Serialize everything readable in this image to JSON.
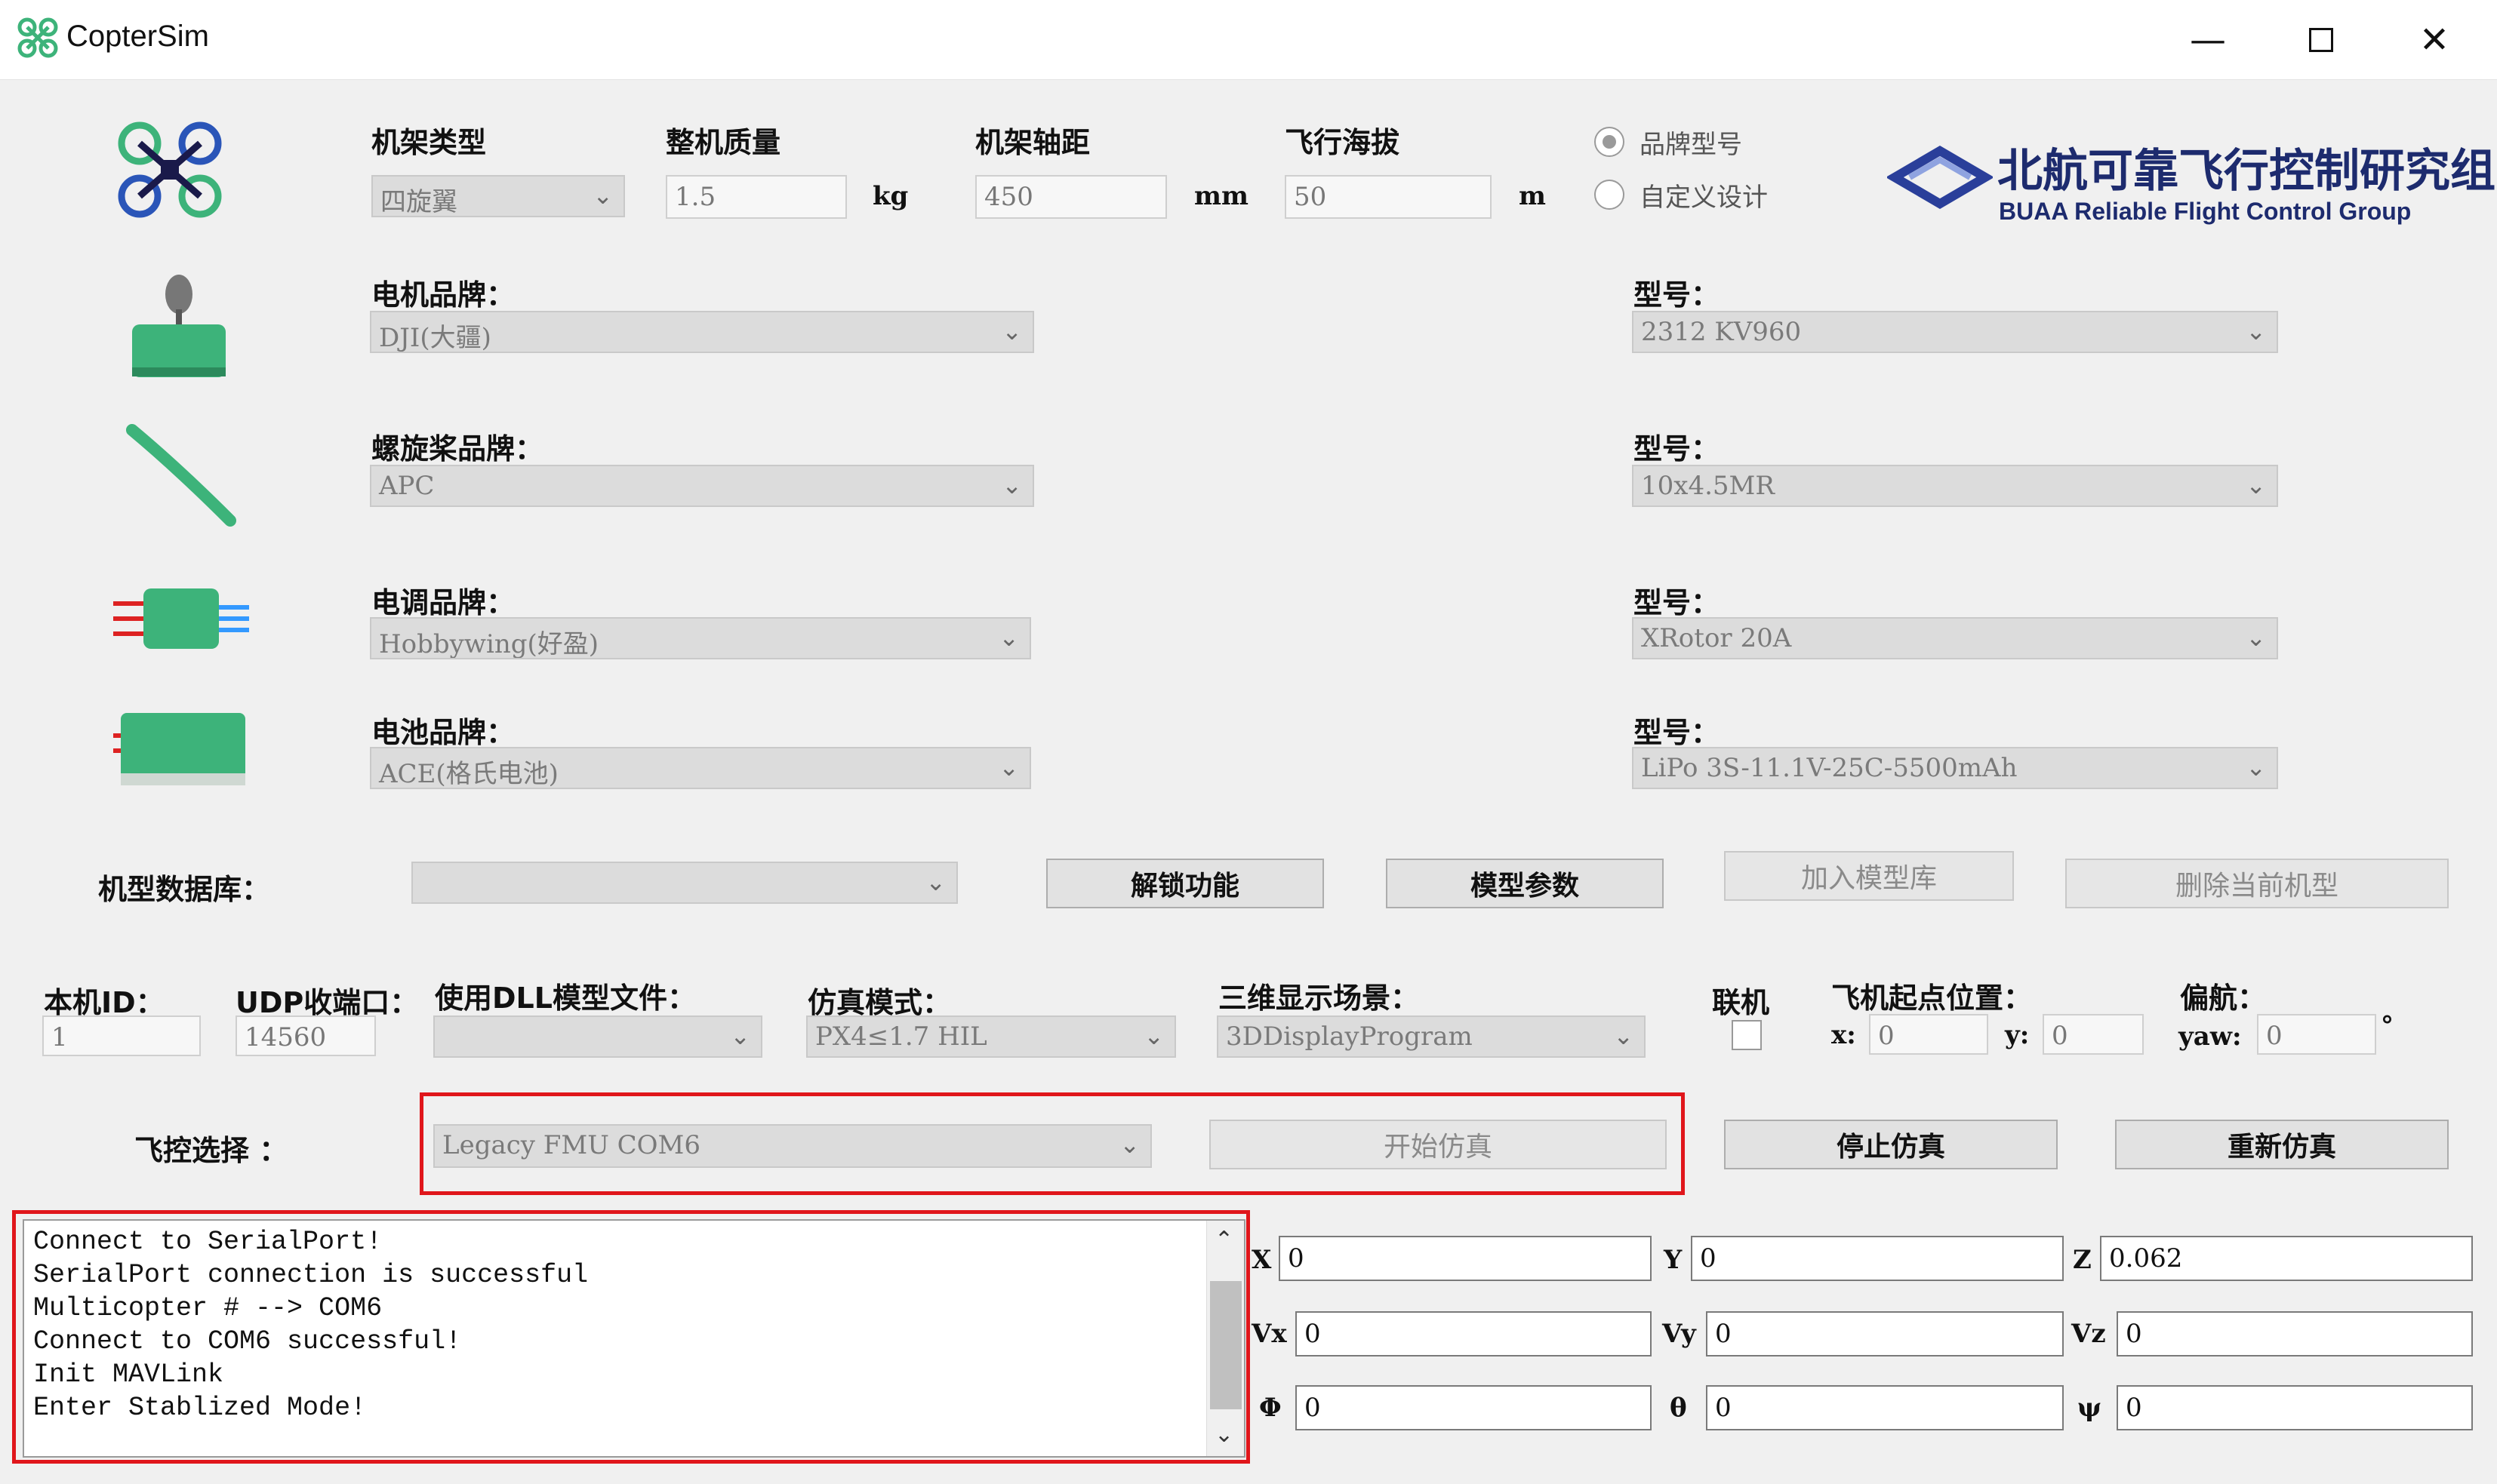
{
  "app": {
    "title": "CopterSim"
  },
  "colors": {
    "accent_red": "#e0161b",
    "logo_blue": "#2a3f9a",
    "motor_green": "#3db37a"
  },
  "frame": {
    "type_label": "机架类型",
    "type_value": "四旋翼",
    "mass_label": "整机质量",
    "mass_value": "1.5",
    "mass_unit": "kg",
    "wheelbase_label": "机架轴距",
    "wheelbase_value": "450",
    "wheelbase_unit": "mm",
    "altitude_label": "飞行海拔",
    "altitude_value": "50",
    "altitude_unit": "m"
  },
  "model_mode": {
    "option_brand": "品牌型号",
    "option_custom": "自定义设计",
    "selected": "品牌型号"
  },
  "logo": {
    "title_cn": "北航可靠飞行控制研究组",
    "title_en": "BUAA Reliable Flight Control Group"
  },
  "components": [
    {
      "icon": "motor-icon",
      "brand_label": "电机品牌：",
      "brand_value": "DJI(大疆)",
      "model_label": "型号：",
      "model_value": "2312 KV960"
    },
    {
      "icon": "propeller-icon",
      "brand_label": "螺旋桨品牌：",
      "brand_value": "APC",
      "model_label": "型号：",
      "model_value": "10x4.5MR"
    },
    {
      "icon": "esc-icon",
      "brand_label": "电调品牌：",
      "brand_value": "Hobbywing(好盈)",
      "model_label": "型号：",
      "model_value": "XRotor 20A"
    },
    {
      "icon": "battery-icon",
      "brand_label": "电池品牌：",
      "brand_value": "ACE(格氏电池)",
      "model_label": "型号：",
      "model_value": "LiPo 3S-11.1V-25C-5500mAh"
    }
  ],
  "database": {
    "label": "机型数据库：",
    "value": "",
    "unlock_button": "解锁功能",
    "params_button": "模型参数",
    "add_button": "加入模型库",
    "delete_button": "删除当前机型"
  },
  "sim": {
    "id_label": "本机ID：",
    "id_value": "1",
    "udp_label": "UDP收端口：",
    "udp_value": "14560",
    "dll_label": "使用DLL模型文件：",
    "dll_value": "",
    "mode_label": "仿真模式：",
    "mode_value": "PX4≤1.7 HIL",
    "scene_label": "三维显示场景：",
    "scene_value": "3DDisplayProgram",
    "online_label": "联机",
    "start_label": "飞机起点位置：",
    "x_label": "x:",
    "x_value": "0",
    "y_label": "y:",
    "y_value": "0",
    "yaw_title": "偏航：",
    "yaw_label": "yaw:",
    "yaw_value": "0",
    "yaw_unit": "°"
  },
  "controller": {
    "label": "飞控选择 ：",
    "value": "Legacy FMU COM6",
    "start_button": "开始仿真",
    "stop_button": "停止仿真",
    "restart_button": "重新仿真"
  },
  "console": {
    "lines": [
      "Connect to SerialPort!",
      "SerialPort connection is successful",
      "Multicopter # --> COM6",
      "Connect to COM6 successful!",
      "Init MAVLink",
      "Enter Stablized Mode!"
    ]
  },
  "state": {
    "x_label": "X",
    "x": "0",
    "y_label": "Y",
    "y": "0",
    "z_label": "Z",
    "z": "0.062",
    "vx_label": "Vx",
    "vx": "0",
    "vy_label": "Vy",
    "vy": "0",
    "vz_label": "Vz",
    "vz": "0",
    "phi_label": "Φ",
    "phi": "0",
    "theta_label": "θ",
    "theta": "0",
    "psi_label": "ψ",
    "psi": "0"
  }
}
